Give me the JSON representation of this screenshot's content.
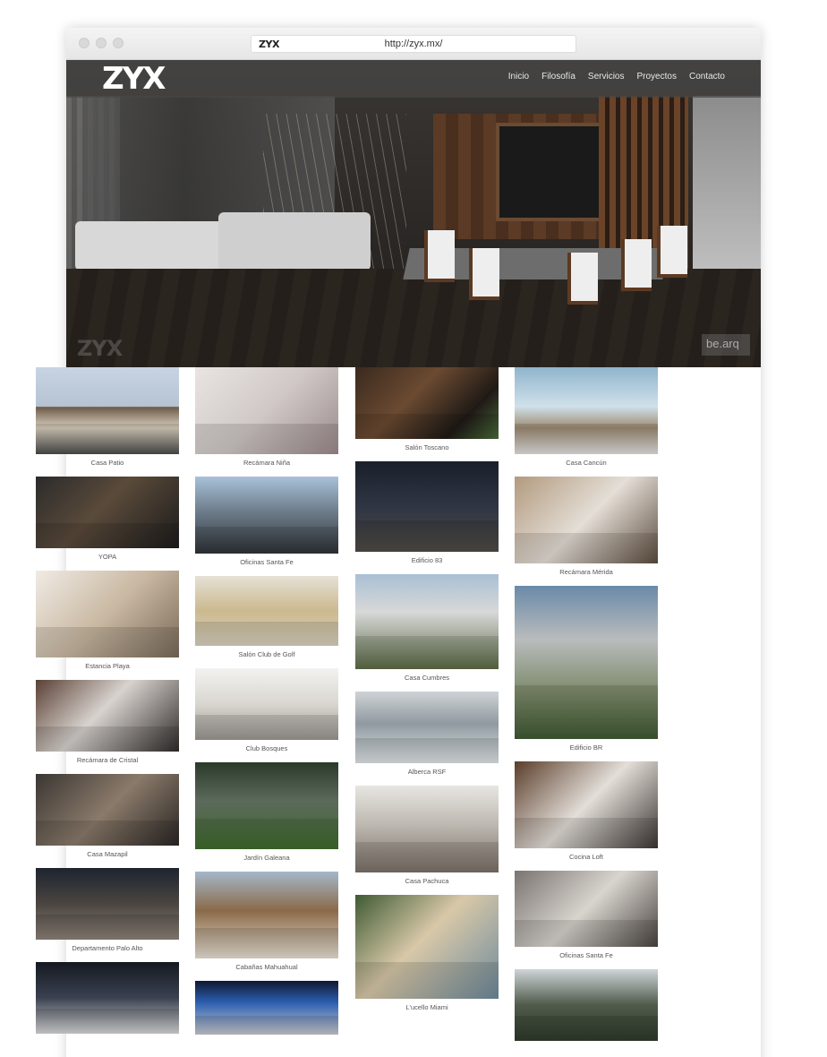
{
  "browser": {
    "favicon_text": "ZYX",
    "url": "http://zyx.mx/"
  },
  "header": {
    "logo": "ZYX",
    "nav": [
      "Inicio",
      "Filosofía",
      "Servicios",
      "Proyectos",
      "Contacto"
    ]
  },
  "hero": {
    "watermark_logo": "ZYX",
    "watermark_credit": "be.arq"
  },
  "gallery": {
    "columns": [
      [
        {
          "caption": "Casa Patio",
          "palette": "p1"
        },
        {
          "caption": "YOPA",
          "palette": "p5"
        },
        {
          "caption": "Estancia Playa",
          "palette": "p9"
        },
        {
          "caption": "Recámara de Cristal",
          "palette": "p13"
        },
        {
          "caption": "Casa Mazapil",
          "palette": "p16"
        },
        {
          "caption": "Departamento Palo Alto",
          "palette": "p20"
        },
        {
          "caption": "",
          "palette": "p24"
        }
      ],
      [
        {
          "caption": "Recámara Niña",
          "palette": "p2"
        },
        {
          "caption": "Oficinas Santa Fe",
          "palette": "p6"
        },
        {
          "caption": "Salón Club de Golf",
          "palette": "p10"
        },
        {
          "caption": "Club Bosques",
          "palette": "p14"
        },
        {
          "caption": "Jardín Galeana",
          "palette": "p17"
        },
        {
          "caption": "Cabañas Mahuahual",
          "palette": "p21"
        },
        {
          "caption": "",
          "palette": "p25"
        }
      ],
      [
        {
          "caption": "Salón Toscano",
          "palette": "p3"
        },
        {
          "caption": "Edificio 83",
          "palette": "p7"
        },
        {
          "caption": "Casa Cumbres",
          "palette": "p11"
        },
        {
          "caption": "Alberca RSF",
          "palette": "p15"
        },
        {
          "caption": "Casa Pachuca",
          "palette": "p18"
        },
        {
          "caption": "L'ucello Miami",
          "palette": "p22"
        }
      ],
      [
        {
          "caption": "Casa Cancún",
          "palette": "p4"
        },
        {
          "caption": "Recámara Mérida",
          "palette": "p8"
        },
        {
          "caption": "Edificio BR",
          "palette": "p12"
        },
        {
          "caption": "Cocina Loft",
          "palette": "p19"
        },
        {
          "caption": "Oficinas Santa Fe",
          "palette": "p23"
        },
        {
          "caption": "",
          "palette": "p26"
        }
      ]
    ]
  }
}
